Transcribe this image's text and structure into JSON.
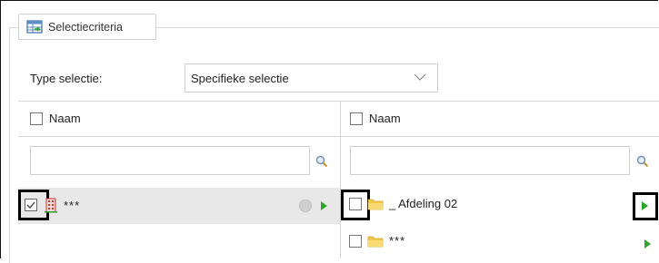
{
  "tab": {
    "label": "Selectiecriteria",
    "icon": "filter-table-icon"
  },
  "type_selectie": {
    "label": "Type selectie:",
    "value": "Specifieke selectie"
  },
  "left_panel": {
    "header": "Naam",
    "search_value": "",
    "rows": [
      {
        "name": "***",
        "checked": true,
        "icon": "building-icon"
      }
    ]
  },
  "right_panel": {
    "header": "Naam",
    "search_value": "",
    "rows": [
      {
        "name": "_ Afdeling 02",
        "checked": false,
        "icon": "folder-icon"
      },
      {
        "name": "***",
        "checked": false,
        "icon": "folder-icon"
      }
    ]
  },
  "colors": {
    "accent_green": "#2aa52a",
    "folder_yellow": "#f2c84b",
    "selected_row": "#e8e8e8"
  }
}
